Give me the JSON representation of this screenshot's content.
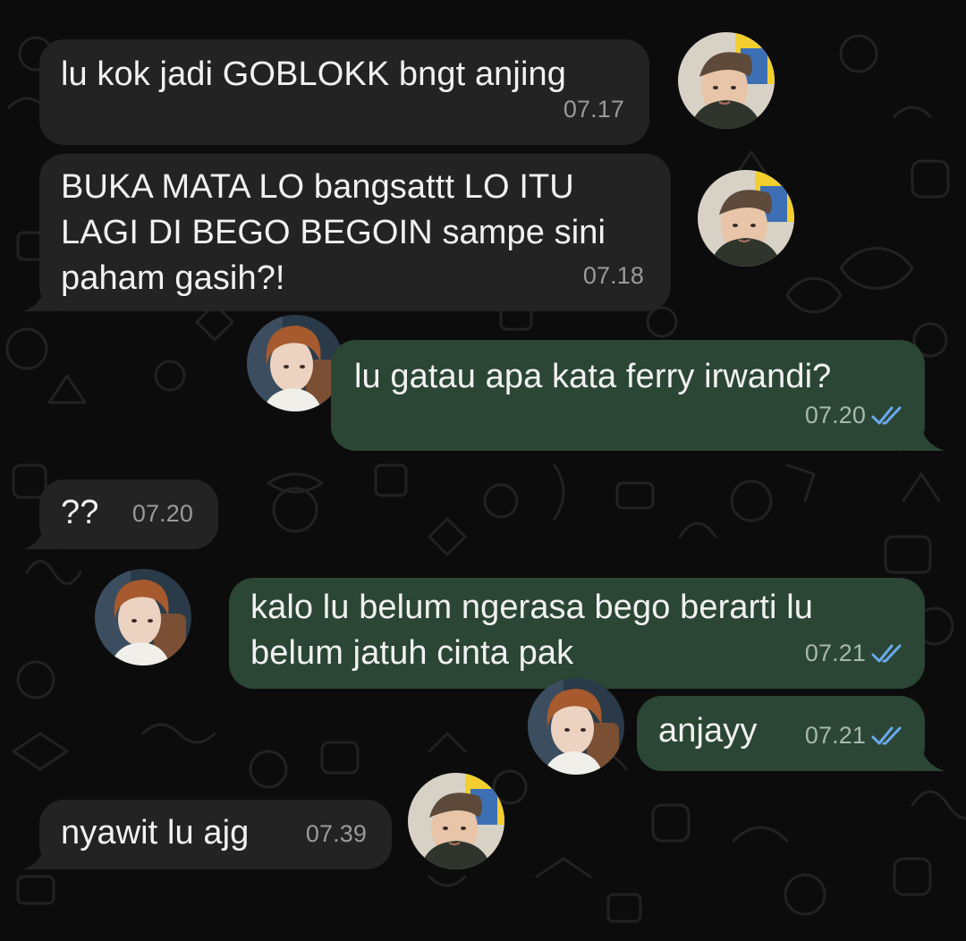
{
  "colors": {
    "background": "#0c0c0c",
    "incoming_bubble": "#232323",
    "outgoing_bubble": "#2b4634",
    "text": "#f2f2f2",
    "time_incoming": "#9a9a9a",
    "time_outgoing": "#a8b7ad",
    "read_check": "#6aa9ee"
  },
  "messages": [
    {
      "direction": "incoming",
      "text": "lu kok jadi GOBLOKK bngt anjing",
      "time": "07.17",
      "avatar": "avatar-boy-yellow"
    },
    {
      "direction": "incoming",
      "text": "BUKA MATA LO bangsattt LO ITU\nLAGI DI BEGO BEGOIN sampe sini\npaham gasih?!",
      "time": "07.18",
      "avatar": "avatar-boy-yellow"
    },
    {
      "direction": "outgoing",
      "text": "lu gatau apa kata ferry irwandi?",
      "time": "07.20",
      "status": "read",
      "avatar": "avatar-boy-brown"
    },
    {
      "direction": "incoming",
      "text": "??",
      "time": "07.20"
    },
    {
      "direction": "outgoing",
      "text": "kalo lu belum ngerasa bego berarti lu\nbelum jatuh cinta pak",
      "time": "07.21",
      "status": "read",
      "avatar": "avatar-boy-brown"
    },
    {
      "direction": "outgoing",
      "text": "anjayy",
      "time": "07.21",
      "status": "read",
      "avatar": "avatar-boy-brown"
    },
    {
      "direction": "incoming",
      "text": "nyawit lu ajg",
      "time": "07.39",
      "avatar": "avatar-boy-yellow"
    }
  ]
}
